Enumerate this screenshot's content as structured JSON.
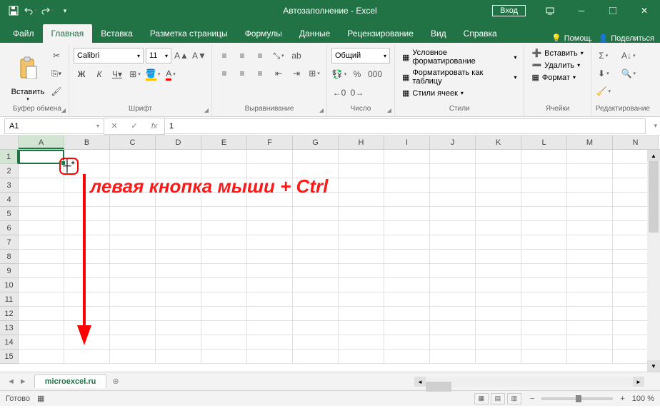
{
  "app": {
    "title": "Автозаполнение - Excel",
    "login": "Вход"
  },
  "tabs": [
    "Файл",
    "Главная",
    "Вставка",
    "Разметка страницы",
    "Формулы",
    "Данные",
    "Рецензирование",
    "Вид",
    "Справка"
  ],
  "tabs_active_index": 1,
  "help_links": {
    "help": "Помощ.",
    "share": "Поделиться"
  },
  "ribbon": {
    "clipboard": {
      "label": "Буфер обмена",
      "paste": "Вставить"
    },
    "font": {
      "label": "Шрифт",
      "name": "Calibri",
      "size": "11"
    },
    "align": {
      "label": "Выравнивание"
    },
    "number": {
      "label": "Число",
      "format": "Общий"
    },
    "styles": {
      "label": "Стили",
      "cond": "Условное форматирование",
      "table": "Форматировать как таблицу",
      "cell": "Стили ячеек"
    },
    "cells": {
      "label": "Ячейки",
      "insert": "Вставить",
      "delete": "Удалить",
      "format": "Формат"
    },
    "editing": {
      "label": "Редактирование"
    }
  },
  "namebox": "A1",
  "formula": "1",
  "columns": [
    "A",
    "B",
    "C",
    "D",
    "E",
    "F",
    "G",
    "H",
    "I",
    "J",
    "K",
    "L",
    "M",
    "N"
  ],
  "rows": [
    "1",
    "2",
    "3",
    "4",
    "5",
    "6",
    "7",
    "8",
    "9",
    "10",
    "11",
    "12",
    "13",
    "14",
    "15"
  ],
  "sheet": "microexcel.ru",
  "status": {
    "ready": "Готово",
    "zoom": "100 %"
  },
  "annotation": "левая кнопка мыши + Ctrl",
  "colors": {
    "brand": "#217346",
    "red": "#ff1a1a"
  }
}
